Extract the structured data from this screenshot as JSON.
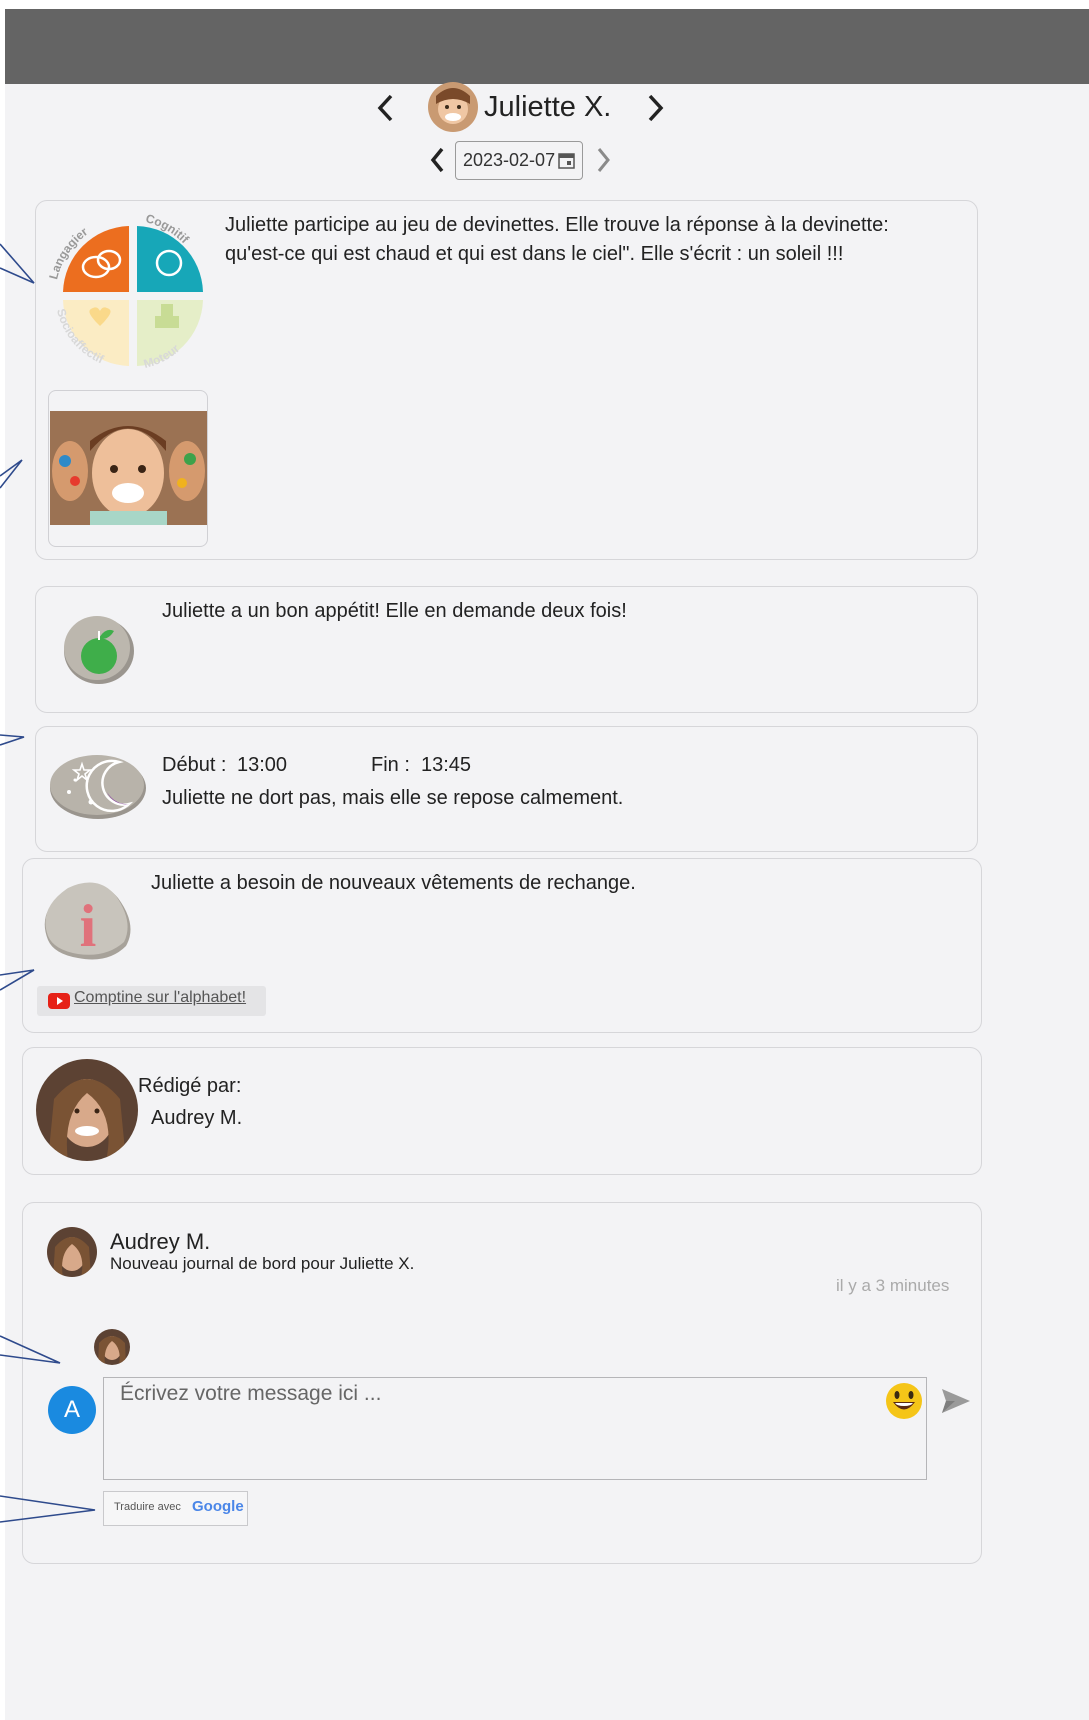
{
  "header": {
    "child_name": "Juliette X.",
    "date_value": "2023-02-07"
  },
  "cards": {
    "development": {
      "categories": [
        "Langagier",
        "Cognitif",
        "Socioaffectif",
        "Moteur"
      ],
      "text": "Juliette participe au jeu de devinettes. Elle trouve la réponse à la devinette: qu'est-ce qui est chaud et qui est dans le ciel\". Elle s'écrit : un soleil !!!"
    },
    "meal": {
      "text": "Juliette a un bon appétit! Elle en demande deux fois!"
    },
    "nap": {
      "start_label": "Début :",
      "start_value": "13:00",
      "end_label": "Fin :",
      "end_value": "13:45",
      "text": "Juliette ne dort pas, mais elle se repose calmement."
    },
    "info": {
      "icon_letter": "i",
      "text": "Juliette a besoin de nouveaux vêtements de rechange.",
      "link_label": "Comptine sur l'alphabet!"
    },
    "author": {
      "label": "Rédigé par:",
      "name": "Audrey M."
    }
  },
  "comments": {
    "notification": {
      "author": "Audrey M.",
      "message": "Nouveau journal de bord pour Juliette X.",
      "time": "il y a 3 minutes"
    },
    "composer": {
      "avatar_letter": "A",
      "placeholder": "Écrivez votre message ici ...",
      "translate_label": "Traduire avec",
      "translate_brand": "Google"
    }
  },
  "colors": {
    "topbar": "#646464",
    "background": "#f3f3f5",
    "avatar_blue": "#1a8ae0",
    "youtube_red": "#e62117",
    "annotation_arrow": "#2e4a8c"
  },
  "icons": [
    "chevron-left-icon",
    "chevron-right-icon",
    "calendar-icon",
    "apple-icon",
    "moon-icon",
    "info-icon",
    "youtube-icon",
    "emoji-icon",
    "send-icon"
  ]
}
